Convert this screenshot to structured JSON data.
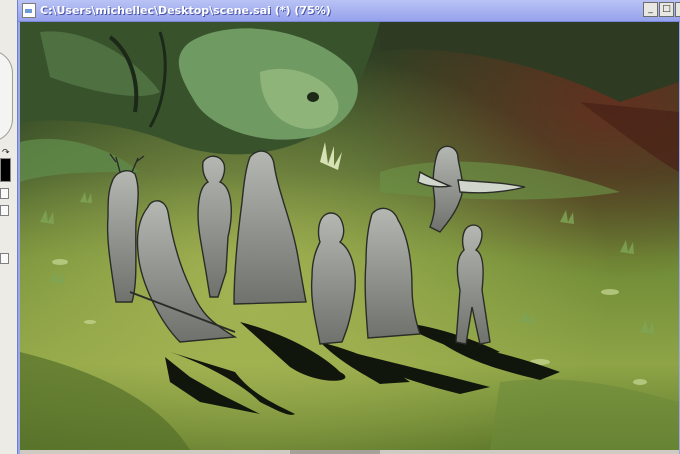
{
  "window": {
    "title": "C:\\Users\\michellec\\Desktop\\scene.sai (*) (75%)",
    "minimize_glyph": "_",
    "maximize_glyph": "□",
    "close_glyph": "×"
  },
  "icons": [
    "document-icon",
    "minimize-icon",
    "maximize-icon",
    "close-icon",
    "color-swatch"
  ],
  "colors": {
    "title_bar": "#9aa8ea",
    "forest_dark": "#2b3a1c",
    "meadow": "#8fa64a",
    "shadow": "#10140c",
    "figure_gray": "#8e918c"
  }
}
